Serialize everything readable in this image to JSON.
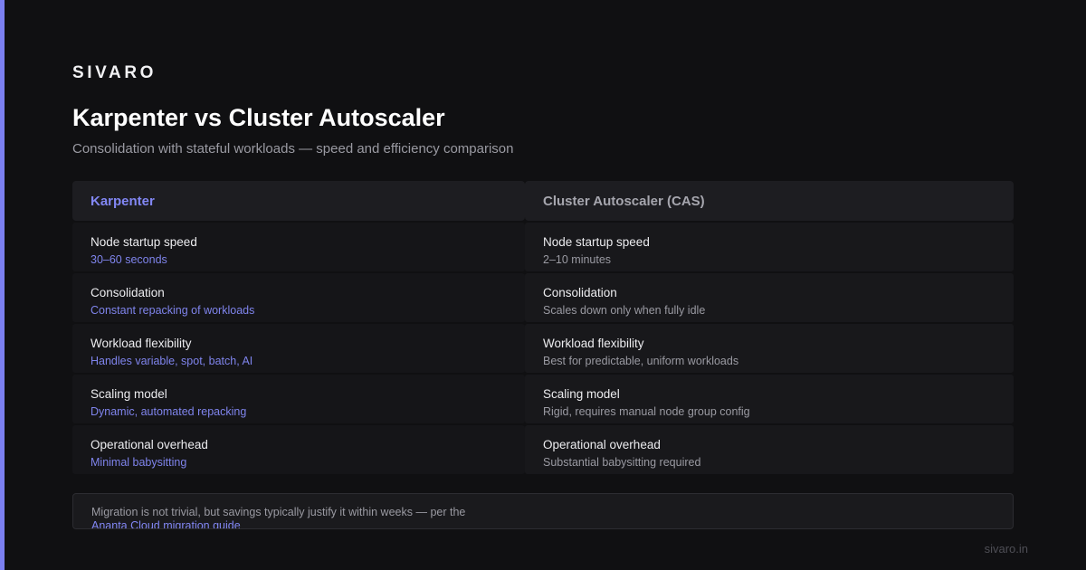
{
  "brand": "SIVARO",
  "title": "Karpenter vs Cluster Autoscaler",
  "subtitle": "Consolidation with stateful workloads — speed and efficiency comparison",
  "colors": {
    "accent": "#7b7ff0",
    "background": "#101012",
    "karpenter_value": "#7f84ec",
    "cas_value": "#9a9aa2"
  },
  "karpenter": {
    "header": "Karpenter",
    "rows": [
      {
        "label": "Node startup speed",
        "value": "30–60 seconds"
      },
      {
        "label": "Consolidation",
        "value": "Constant repacking of workloads"
      },
      {
        "label": "Workload flexibility",
        "value": "Handles variable, spot, batch, AI"
      },
      {
        "label": "Scaling model",
        "value": "Dynamic, automated repacking"
      },
      {
        "label": "Operational overhead",
        "value": "Minimal babysitting"
      }
    ]
  },
  "cas": {
    "header": "Cluster Autoscaler (CAS)",
    "rows": [
      {
        "label": "Node startup speed",
        "value": "2–10 minutes"
      },
      {
        "label": "Consolidation",
        "value": "Scales down only when fully idle"
      },
      {
        "label": "Workload flexibility",
        "value": "Best for predictable, uniform workloads"
      },
      {
        "label": "Scaling model",
        "value": "Rigid, requires manual node group config"
      },
      {
        "label": "Operational overhead",
        "value": "Substantial babysitting required"
      }
    ]
  },
  "footer": {
    "text": "Migration is not trivial, but savings typically justify it within weeks — per the",
    "link": "Ananta Cloud migration guide"
  },
  "domain": "sivaro.in"
}
